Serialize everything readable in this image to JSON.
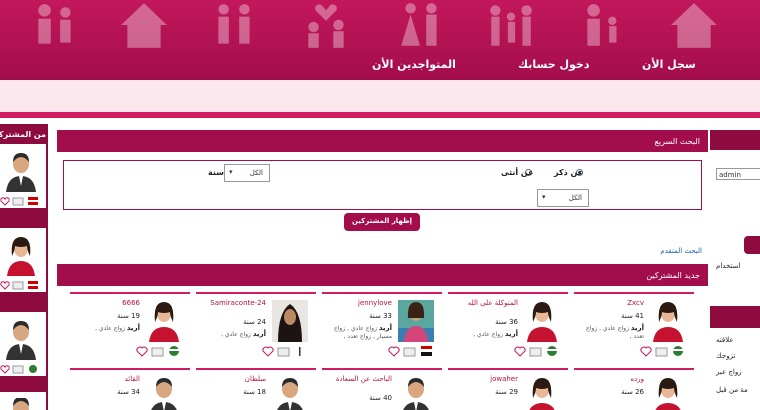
{
  "header": {
    "nav": {
      "register": "سجل الأن",
      "login": "دخول حسابك",
      "online": "المتواجدين الأن"
    }
  },
  "left_panel": {
    "title": "من المشتركين"
  },
  "right_panel": {
    "username_value": "admin",
    "texts": [
      "استخدام",
      "علاقته",
      "تزوجك",
      "زواج عبر",
      "مة من قبل"
    ]
  },
  "quick_search": {
    "title": "البحث السريع",
    "male_label": "عن ذكر",
    "female_label": "عن أنثى",
    "age_label": "سنة",
    "age_select": "الكل",
    "country_select": "الكل",
    "submit": "إظهار المشتركين",
    "advanced_link": "البحث المتقدم"
  },
  "members": {
    "title": "جديد المشتركين",
    "row1": [
      {
        "name": "Zxcv",
        "age": "41 سنة",
        "want_label": "أريد",
        "want": "زواج عادي , زواج تعدد ,"
      },
      {
        "name": "المتوكلة على الله",
        "age": "36 سنة",
        "want_label": "أريد",
        "want": "زواج عادي ,"
      },
      {
        "name": "jennylove",
        "age": "33 سنة",
        "want_label": "أريد",
        "want": "زواج عادي , زواج مسيار , زواج تعدد ,"
      },
      {
        "name": "Samiraconte-24",
        "age": "24 سنة",
        "want_label": "أريد",
        "want": "زواج عادي ,"
      },
      {
        "name": "6666",
        "age": "19 سنة",
        "want_label": "أريد",
        "want": "زواج عادي ,"
      }
    ],
    "row2": [
      {
        "name": "ورده",
        "age": "26 سنة"
      },
      {
        "name": "jowaher",
        "age": "29 سنة"
      },
      {
        "name": "الباحث عن السعادة",
        "age": "40 سنة"
      },
      {
        "name": "سلطان",
        "age": "18 سنة"
      },
      {
        "name": "القائد",
        "age": "34 سنة"
      }
    ]
  },
  "colors": {
    "primary": "#a30d4b",
    "accent": "#d21b63",
    "link": "#1a5fb4"
  }
}
